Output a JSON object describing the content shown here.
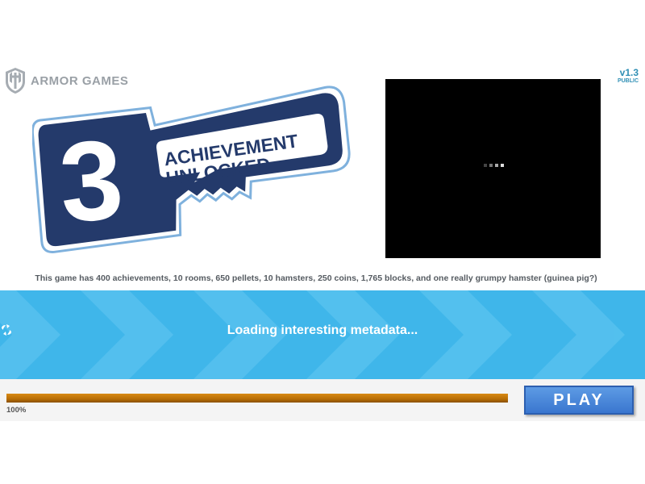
{
  "publisher": {
    "name": "ARMOR GAMES"
  },
  "version": {
    "number": "v1.3",
    "channel": "PUBLIC"
  },
  "title": {
    "digit": "3",
    "line1": "ACHIEVEMENT",
    "line2": "UNLOCKED"
  },
  "blurb": "This game has 400 achievements, 10 rooms, 650 pellets,  10 hamsters, 250 coins, 1,765 blocks, and one really grumpy hamster (guinea pig?)",
  "loader": {
    "message": "Loading interesting metadata...",
    "progress_percent": 100,
    "progress_label": "100%"
  },
  "play_button": {
    "label": "PLAY"
  },
  "colors": {
    "title_navy": "#243a6b",
    "title_outline": "#7fb1dd",
    "banner": "#3fb6ea",
    "progress": "#c07808",
    "play_button": "#4a86d8"
  },
  "icons": {
    "logo": "shield-icon",
    "loading": "spinner-icon"
  }
}
